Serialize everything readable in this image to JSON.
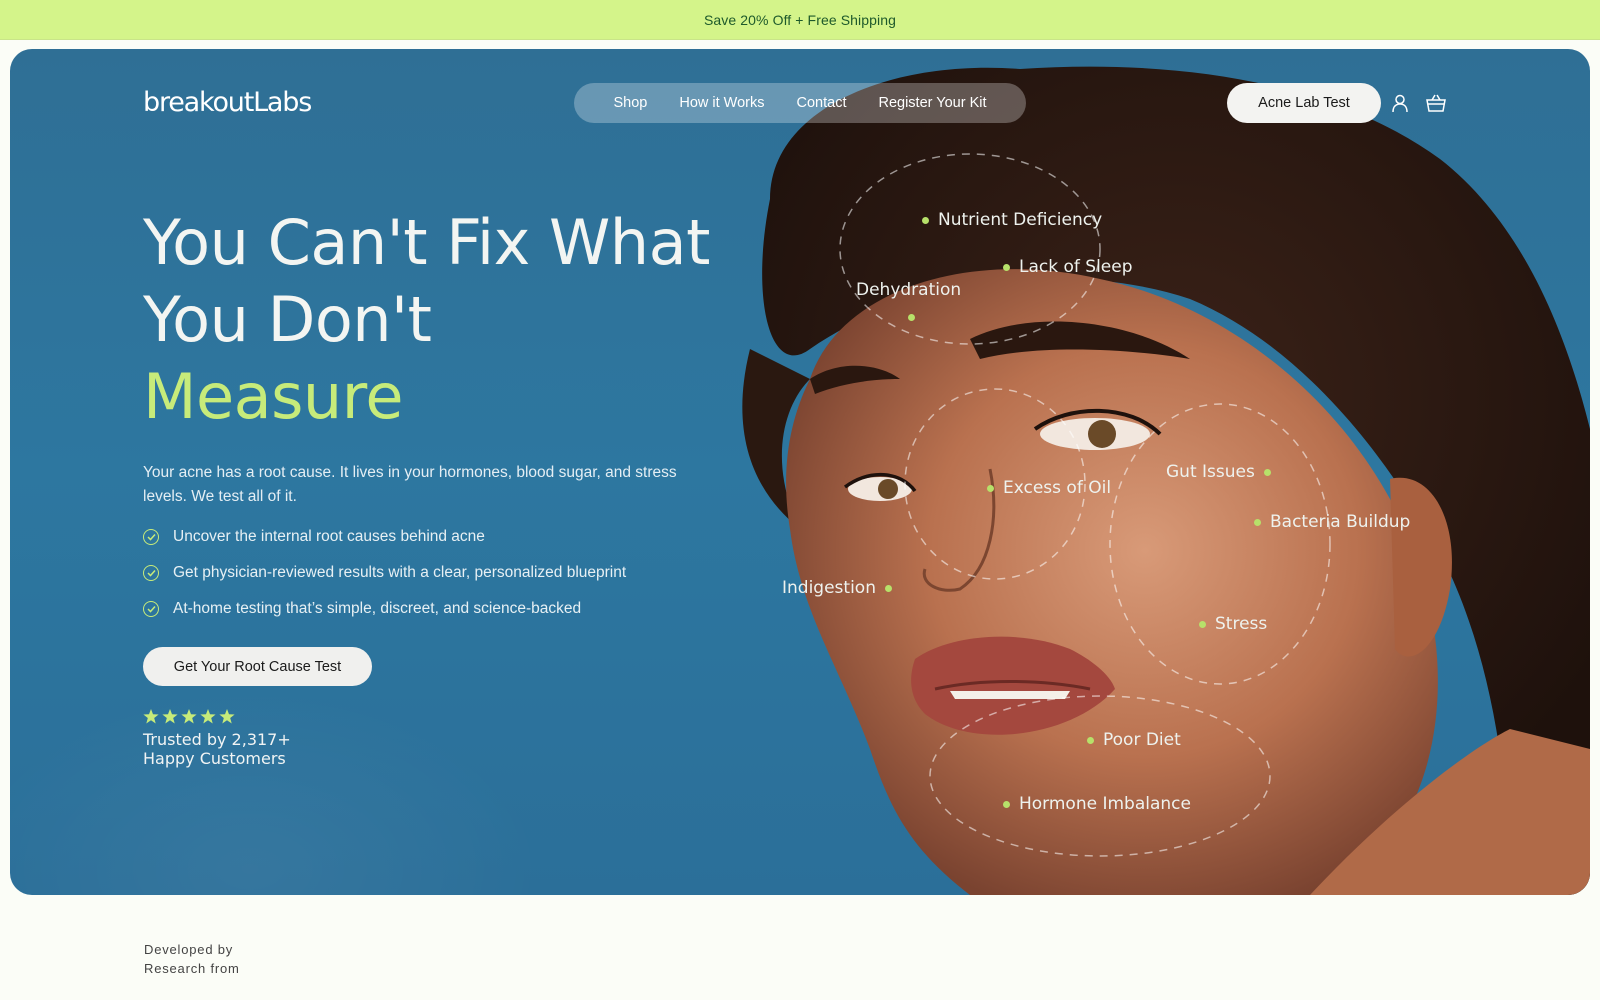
{
  "promo": {
    "text": "Save 20% Off + Free Shipping"
  },
  "header": {
    "logo": "breakoutLabs",
    "nav": [
      "Shop",
      "How it Works",
      "Contact",
      "Register Your Kit"
    ],
    "cta_label": "Acne Lab Test",
    "icons": [
      "user-icon",
      "basket-icon"
    ]
  },
  "hero": {
    "headline_line1": "You Can't Fix What",
    "headline_line2": "You Don't",
    "headline_accent": "Measure",
    "subtext": "Your acne has a root cause. It lives in your hormones, blood sugar, and stress levels. We test all of it.",
    "bullets": [
      "Uncover the internal root causes behind acne",
      "Get physician-reviewed results with a clear, personalized blueprint",
      "At-home testing that’s simple, discreet, and science-backed"
    ],
    "cta_label": "Get Your Root Cause Test",
    "rating_stars": 5,
    "trust_line1": "Trusted by 2,317+",
    "trust_line2": "Happy Customers"
  },
  "face_labels": {
    "nutrient": "Nutrient Deficiency",
    "sleep": "Lack of Sleep",
    "dehydration": "Dehydration",
    "oil": "Excess of Oil",
    "gut": "Gut Issues",
    "bacteria": "Bacteria Buildup",
    "indigestion": "Indigestion",
    "stress": "Stress",
    "diet": "Poor Diet",
    "hormone": "Hormone Imbalance"
  },
  "footer": {
    "developed_line1": "Developed by",
    "developed_line2": "Research from"
  },
  "colors": {
    "promo_bg": "#d4f48a",
    "hero_blue": "#2d77a0",
    "accent_green": "#c7eb7a",
    "dot_green": "#b7e16a"
  }
}
